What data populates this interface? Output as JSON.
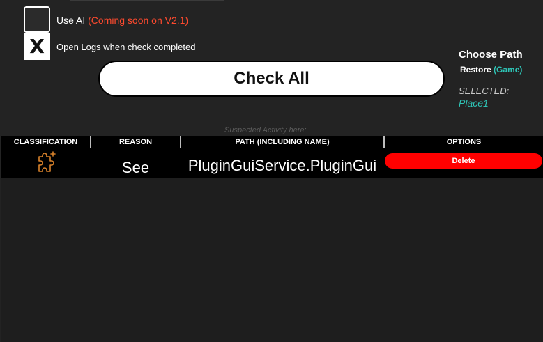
{
  "settings": {
    "use_ai": {
      "label": "Use AI",
      "note": "(Coming soon on V2.1)",
      "checked": false
    },
    "open_logs": {
      "label": "Open Logs when check completed",
      "mark": "X",
      "checked": true
    }
  },
  "actions": {
    "check_all_label": "Check All"
  },
  "path_panel": {
    "title": "Choose Path",
    "restore_label": "Restore",
    "restore_target": "(Game)",
    "selected_label": "SELECTED:",
    "selected_value": "Place1"
  },
  "results": {
    "caption": "Suspected Activity here:",
    "columns": {
      "classification": "CLASSIFICATION",
      "reason": "REASON",
      "path": "PATH (INCLUDING NAME)",
      "options": "OPTIONS"
    },
    "rows": [
      {
        "classification_icon": "plugin-puzzle-icon",
        "reason": "See",
        "path": "PluginGuiService.PluginGui",
        "delete_label": "Delete"
      }
    ]
  },
  "colors": {
    "background": "#232323",
    "panel": "#1e1e1e",
    "accent_teal": "#2ec4b6",
    "warning_orange": "#ff4a2e",
    "danger_red": "#ff0000",
    "icon_orange": "#d9822b"
  }
}
